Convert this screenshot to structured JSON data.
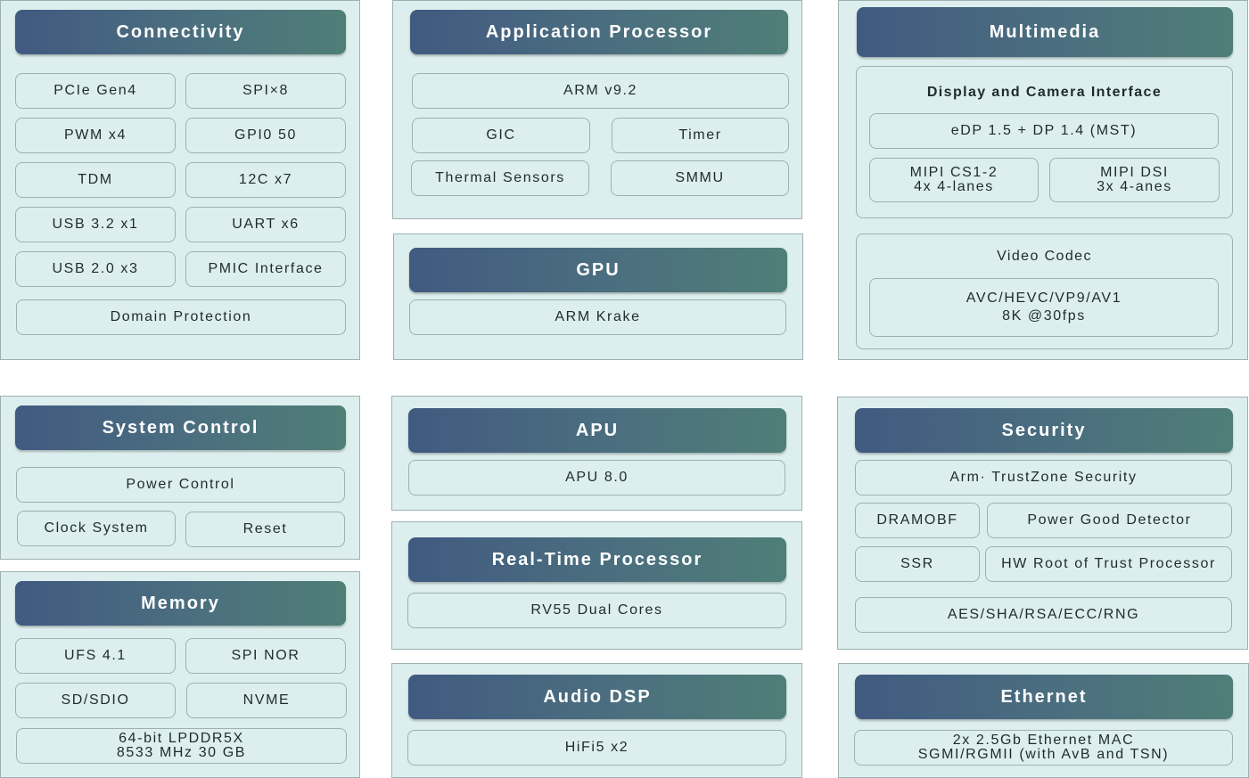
{
  "connectivity": {
    "title": "Connectivity",
    "items": [
      "PCIe Gen4",
      "SPI×8",
      "PWM x4",
      "GPI0 50",
      "TDM",
      "12C x7",
      "USB 3.2 x1",
      "UART x6",
      "USB 2.0 x3",
      "PMIC Interface",
      "Domain Protection"
    ]
  },
  "application_processor": {
    "title": "Application Processor",
    "items": [
      "ARM v9.2",
      "GIC",
      "Timer",
      "Thermal Sensors",
      "SMMU"
    ]
  },
  "gpu": {
    "title": "GPU",
    "items": [
      "ARM Krake"
    ]
  },
  "multimedia": {
    "title": "Multimedia",
    "display_camera": {
      "title": "Display and Camera Interface",
      "edp": "eDP 1.5 + DP 1.4 (MST)",
      "mipi_csi": [
        "MIPI CS1-2",
        "4x 4-lanes"
      ],
      "mipi_dsi": [
        "MIPI DSI",
        "3x 4-anes"
      ]
    },
    "video_codec": {
      "title": "Video Codec",
      "formats": [
        "AVC/HEVC/VP9/AV1",
        "8K @30fps"
      ]
    }
  },
  "system_control": {
    "title": "System Control",
    "items": [
      "Power Control",
      "Clock System",
      "Reset"
    ]
  },
  "memory": {
    "title": "Memory",
    "items": [
      "UFS 4.1",
      "SPI NOR",
      "SD/SDIO",
      "NVME"
    ],
    "dram": [
      "64-bit LPDDR5X",
      "8533 MHz 30 GB"
    ]
  },
  "apu": {
    "title": "APU",
    "items": [
      "APU 8.0"
    ]
  },
  "rtp": {
    "title": "Real-Time Processor",
    "items": [
      "RV55 Dual Cores"
    ]
  },
  "audio_dsp": {
    "title": "Audio DSP",
    "items": [
      "HiFi5 x2"
    ]
  },
  "security": {
    "title": "Security",
    "items": [
      "Arm· TrustZone  Security",
      "DRAMOBF",
      "Power Good Detector",
      "SSR",
      "HW Root of Trust Processor",
      "AES/SHA/RSA/ECC/RNG"
    ]
  },
  "ethernet": {
    "title": "Ethernet",
    "items": [
      "2x 2.5Gb Ethernet MAC",
      "SGMI/RGMII (with AvB and TSN)"
    ]
  }
}
